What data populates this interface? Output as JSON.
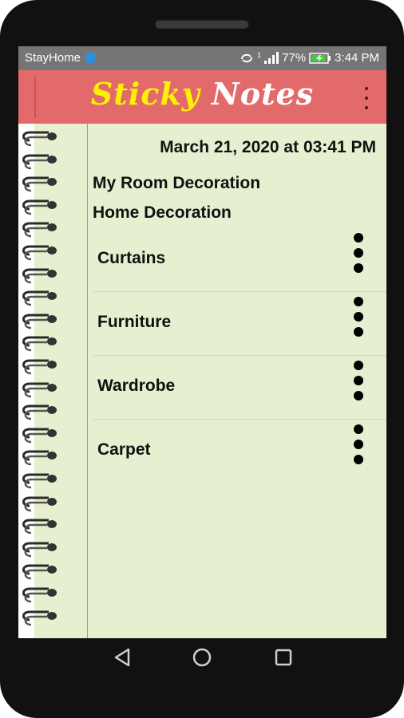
{
  "status_bar": {
    "app_name": "StayHome",
    "network": "1",
    "battery": "77%",
    "time": "3:44 PM"
  },
  "app_bar": {
    "title_part1": "Sticky",
    "title_part2": "Notes",
    "menu_icon": "more-vertical-icon"
  },
  "note": {
    "date": "March 21, 2020 at 03:41 PM",
    "folder": "My Room Decoration",
    "subfolder": "Home Decoration",
    "items": [
      {
        "label": "Curtains"
      },
      {
        "label": "Furniture"
      },
      {
        "label": "Wardrobe"
      },
      {
        "label": "Carpet"
      }
    ]
  },
  "nav_bar": {
    "back_icon": "back-triangle-icon",
    "home_icon": "home-circle-icon",
    "recents_icon": "recents-square-icon"
  },
  "colors": {
    "app_bar": "#e26a6a",
    "title_yellow": "#fff200",
    "paper": "#e6efcf",
    "status_bar": "#757575"
  }
}
